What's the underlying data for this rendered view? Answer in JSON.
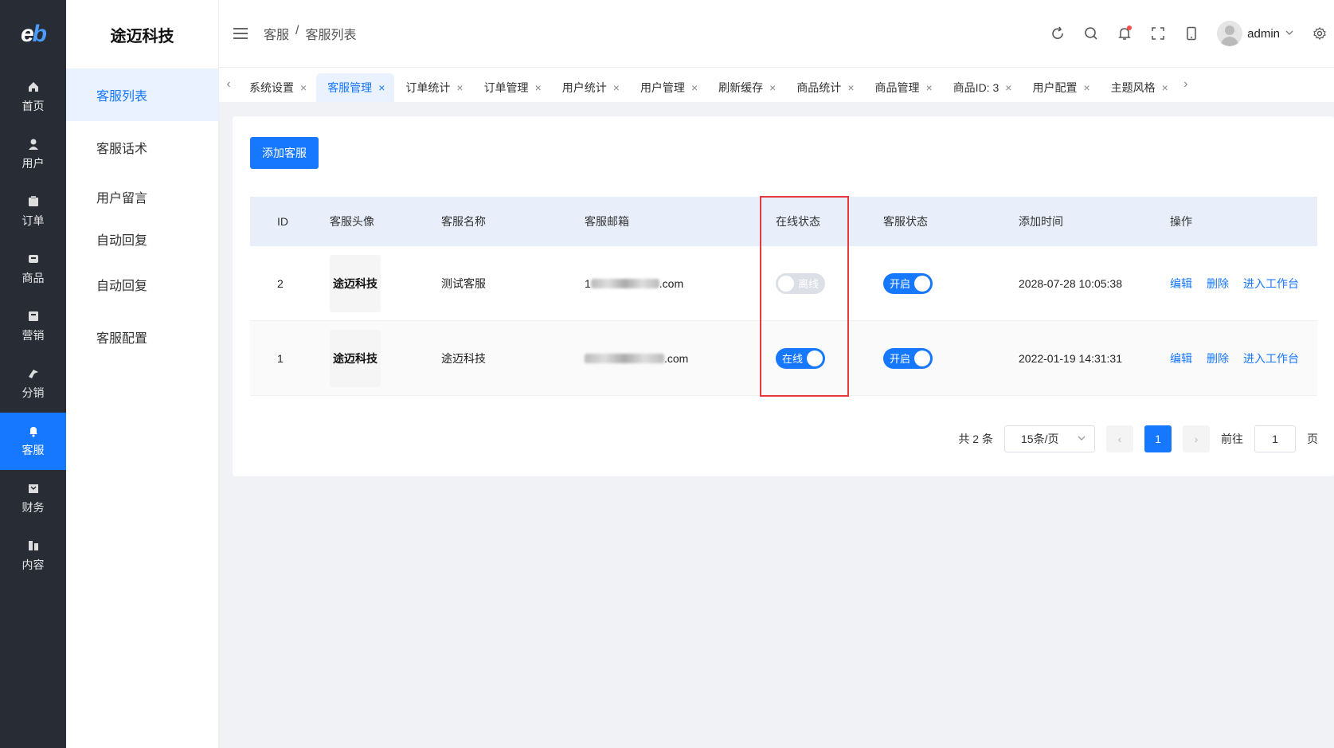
{
  "app": {
    "logo": "eb",
    "brand_title": "途迈科技"
  },
  "rail": [
    {
      "label": "首页",
      "icon": "home-icon"
    },
    {
      "label": "用户",
      "icon": "user-icon"
    },
    {
      "label": "订单",
      "icon": "order-icon"
    },
    {
      "label": "商品",
      "icon": "product-icon"
    },
    {
      "label": "营销",
      "icon": "marketing-icon"
    },
    {
      "label": "分销",
      "icon": "distribution-icon"
    },
    {
      "label": "客服",
      "icon": "bell-icon",
      "active": true
    },
    {
      "label": "财务",
      "icon": "finance-icon"
    },
    {
      "label": "内容",
      "icon": "content-icon"
    }
  ],
  "subnav": {
    "items": [
      "客服列表",
      "客服话术",
      "用户留言",
      "自动回复",
      "自动回复",
      "客服配置"
    ]
  },
  "header": {
    "breadcrumb": [
      "客服",
      "/",
      "客服列表"
    ],
    "username": "admin"
  },
  "tabs": [
    "系统设置",
    "客服管理",
    "订单统计",
    "订单管理",
    "用户统计",
    "用户管理",
    "刷新缓存",
    "商品统计",
    "商品管理",
    "商品ID: 3",
    "用户配置",
    "主题风格"
  ],
  "toolbar": {
    "add_label": "添加客服"
  },
  "table": {
    "columns": [
      "ID",
      "客服头像",
      "客服名称",
      "客服邮箱",
      "在线状态",
      "客服状态",
      "添加时间",
      "操作"
    ],
    "rows": [
      {
        "id": "2",
        "avatar": "途迈科技",
        "name": "测试客服",
        "email_prefix": "1",
        "email_suffix": ".com",
        "online": "离线",
        "status": "开启",
        "time": "2028-07-28 10:05:38"
      },
      {
        "id": "1",
        "avatar": "途迈科技",
        "name": "途迈科技",
        "email_prefix": "",
        "email_suffix": ".com",
        "online": "在线",
        "status": "开启",
        "time": "2022-01-19 14:31:31"
      }
    ],
    "actions": [
      "编辑",
      "删除",
      "进入工作台"
    ]
  },
  "pagination": {
    "total": "共 2 条",
    "page_size": "15条/页",
    "current": "1",
    "goto_label": "前往",
    "goto_value": "1",
    "page_unit": "页"
  },
  "colors": {
    "primary": "#1677ff",
    "rail_bg": "#282c34",
    "highlight": "#e5393b"
  }
}
